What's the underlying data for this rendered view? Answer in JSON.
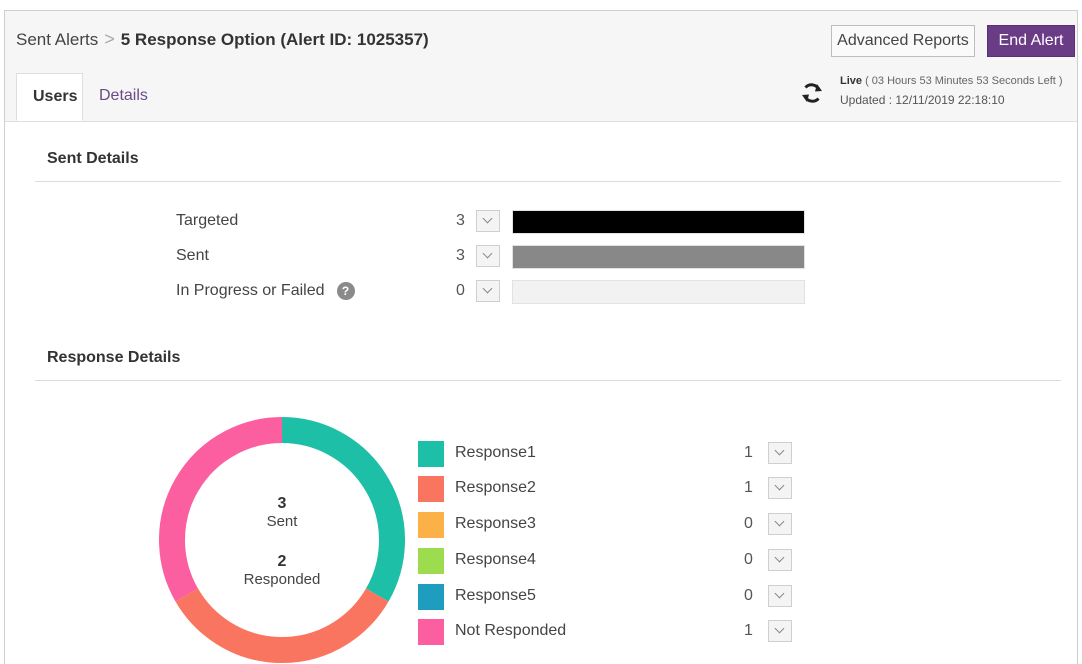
{
  "header": {
    "breadcrumb_root": "Sent Alerts",
    "breadcrumb_sep": ">",
    "breadcrumb_current": "5 Response Option (Alert ID: 1025357)",
    "advanced_reports": "Advanced Reports",
    "end_alert": "End Alert"
  },
  "tabs": [
    {
      "label": "Users",
      "active": true
    },
    {
      "label": "Details",
      "active": false
    }
  ],
  "status": {
    "live_label": "Live",
    "time_left": " ( 03 Hours 53 Minutes 53 Seconds Left )",
    "updated": "Updated :  12/11/2019 22:18:10",
    "icon": "refresh-icon"
  },
  "sent_details": {
    "title": "Sent Details",
    "rows": [
      {
        "label": "Targeted",
        "count": "3",
        "value": 3,
        "color": "#000000"
      },
      {
        "label": "Sent",
        "count": "3",
        "value": 3,
        "color": "#888888"
      },
      {
        "label": "In Progress or Failed",
        "count": "0",
        "value": 0,
        "color": "#f2f2f2",
        "help_icon": "?"
      }
    ],
    "max": 3
  },
  "response_details": {
    "title": "Response Details",
    "sent_count": "3",
    "sent_label": "Sent",
    "responded_count": "2",
    "responded_label": "Responded",
    "items": [
      {
        "label": "Response1",
        "count": "1",
        "value": 1,
        "color": "#1dbfa7"
      },
      {
        "label": "Response2",
        "count": "1",
        "value": 1,
        "color": "#f97560"
      },
      {
        "label": "Response3",
        "count": "0",
        "value": 0,
        "color": "#fbb147"
      },
      {
        "label": "Response4",
        "count": "0",
        "value": 0,
        "color": "#9ddc4f"
      },
      {
        "label": "Response5",
        "count": "0",
        "value": 0,
        "color": "#1e9dbf"
      },
      {
        "label": "Not Responded",
        "count": "1",
        "value": 1,
        "color": "#fb5f9f"
      }
    ]
  },
  "colors": {
    "accent": "#6b3c86",
    "tab_link": "#6b4b86"
  }
}
